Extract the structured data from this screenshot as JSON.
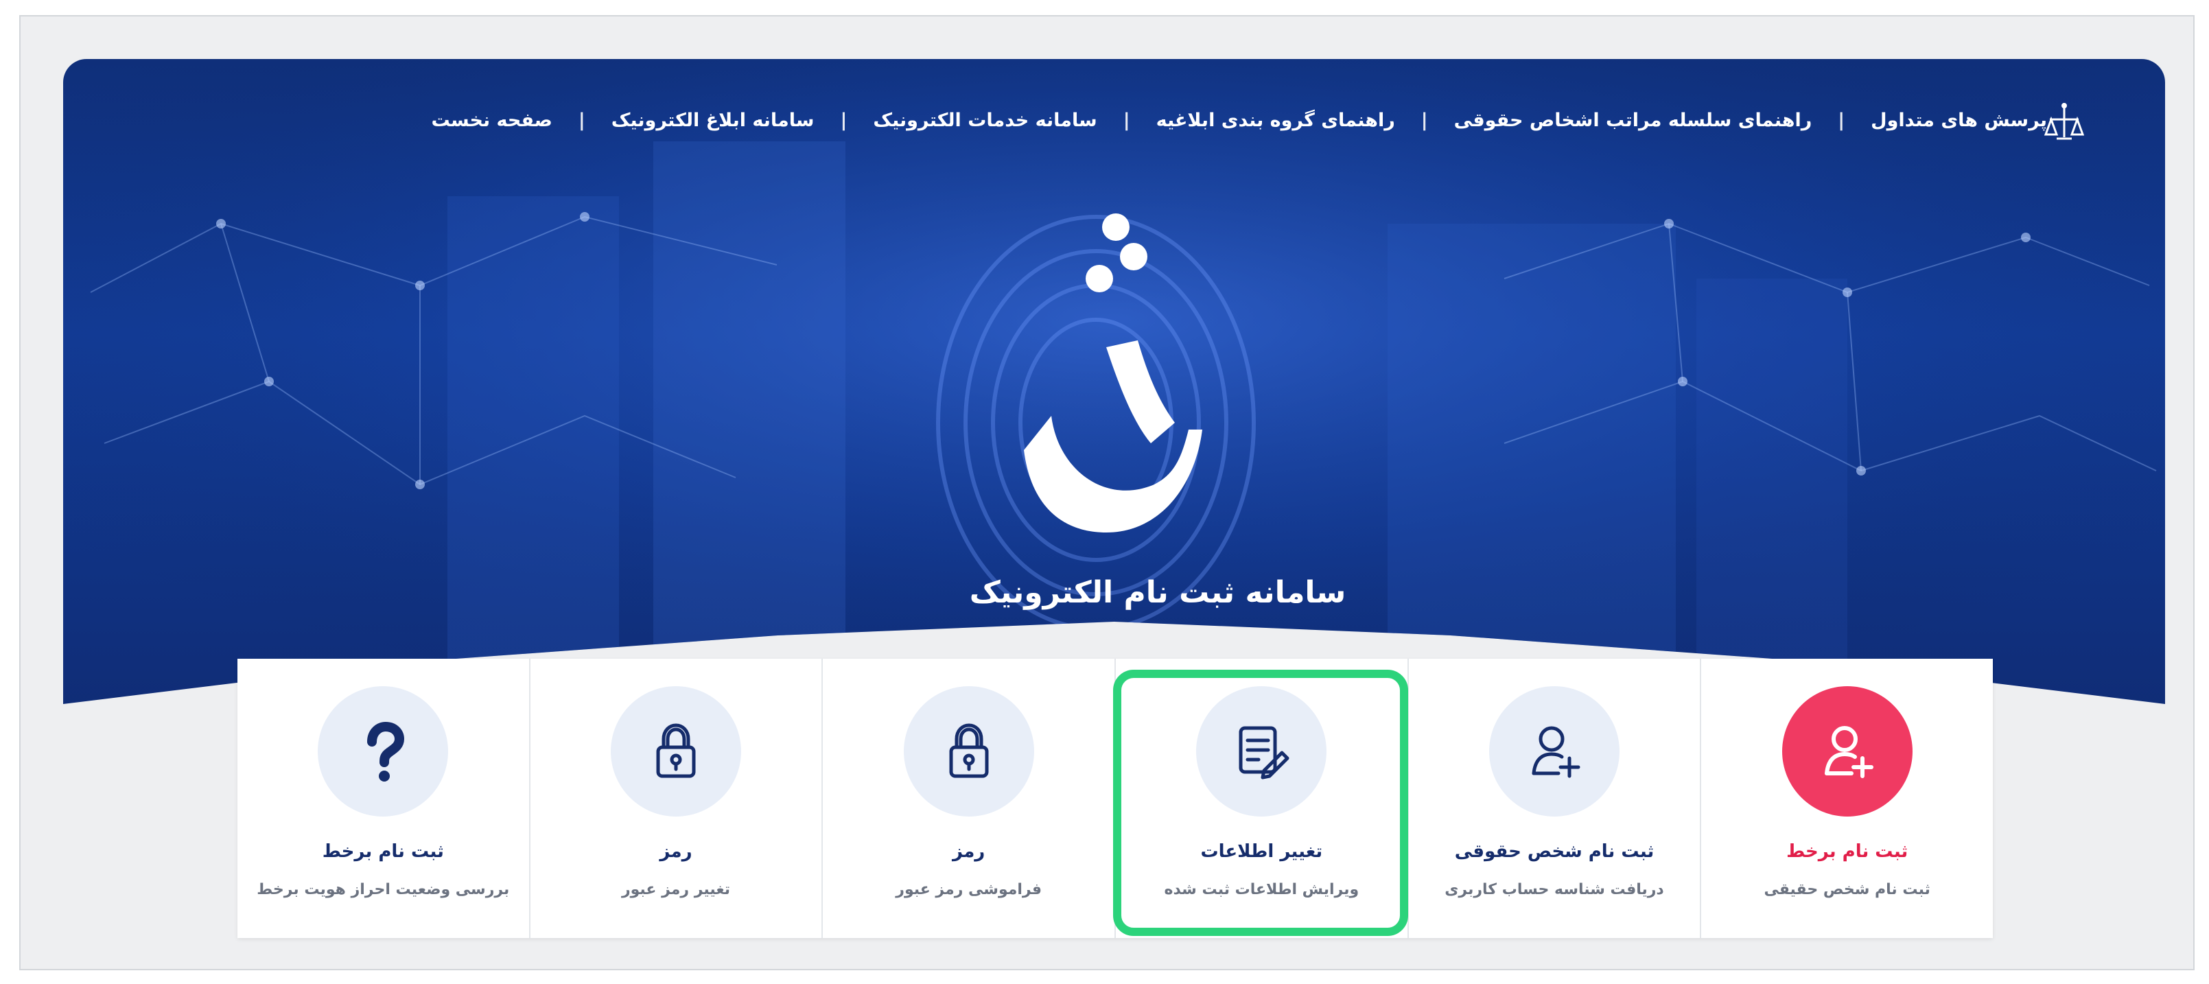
{
  "app": {
    "title": "سامانه ثبت نام الکترونیک",
    "logo_glyph": "ثنا"
  },
  "nav": {
    "items": [
      "صفحه نخست",
      "سامانه ابلاغ الکترونیک",
      "سامانه خدمات الکترونیک",
      "راهنمای گروه بندی ابلاغیه",
      "راهنمای سلسله مراتب اشخاص حقوقی",
      "پرسش های متداول"
    ],
    "separator": "|"
  },
  "cards": [
    {
      "title": "ثبت نام برخط",
      "subtitle": "ثبت نام شخص حقیقی",
      "icon": "add-user-icon",
      "accent": "#f03a62"
    },
    {
      "title": "ثبت نام شخص حقوقی",
      "subtitle": "دریافت شناسه حساب کاربری",
      "icon": "add-user-icon"
    },
    {
      "title": "تغییر اطلاعات",
      "subtitle": "ویرایش اطلاعات ثبت شده",
      "icon": "edit-document-icon",
      "highlighted": true
    },
    {
      "title": "رمز",
      "subtitle": "فراموشی رمز عبور",
      "icon": "lock-icon"
    },
    {
      "title": "رمز",
      "subtitle": "تغییر رمز عبور",
      "icon": "lock-icon"
    },
    {
      "title": "ثبت نام برخط",
      "subtitle": "بررسی وضعیت احراز هویت برخط",
      "icon": "question-icon"
    }
  ],
  "colors": {
    "hero": "#123b96",
    "pink": "#f03a62",
    "highlight": "#2cd37b",
    "navy_text": "#152c6b"
  }
}
